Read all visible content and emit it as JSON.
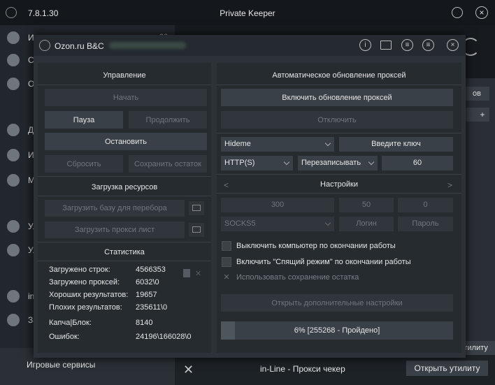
{
  "app": {
    "version": "7.8.1.30",
    "title": "Private Keeper"
  },
  "sidebar": {
    "items": [
      {
        "label": "И",
        "count": "20"
      },
      {
        "label": "С"
      },
      {
        "label": "О"
      },
      {
        "label": "Д"
      },
      {
        "label": "И"
      },
      {
        "label": "М"
      },
      {
        "label": "Ул"
      },
      {
        "label": "Ул"
      },
      {
        "label": "in"
      },
      {
        "label": "За"
      }
    ],
    "bottom_label": "Игровые сервисы"
  },
  "main": {
    "right_tab": "ов",
    "plus": "+",
    "strip_label": "утилиту",
    "bottom_label": "in-Line - Прокси чекер",
    "open_utility": "Открыть утилиту"
  },
  "dialog": {
    "title": "Ozon.ru B&C",
    "control": {
      "title": "Управление",
      "start": "Начать",
      "pause": "Пауза",
      "resume": "Продолжить",
      "stop": "Остановить",
      "reset": "Сбросить",
      "save_rest": "Сохранить остаток"
    },
    "resources": {
      "title": "Загрузка ресурсов",
      "load_base": "Загрузить базу для перебора",
      "load_proxy": "Загрузить прокси лист"
    },
    "stats": {
      "title": "Статистика",
      "rows": [
        {
          "k": "Загружено строк:",
          "v": "4566353"
        },
        {
          "k": "Загружено проксей:",
          "v": "6032\\0"
        },
        {
          "k": "Хороших результатов:",
          "v": "19657"
        },
        {
          "k": "Плохих результатов:",
          "v": "235611\\0"
        },
        {
          "k": "Капча|Блок:",
          "v": "8140"
        },
        {
          "k": "Ошибок:",
          "v": "24196\\166028\\0"
        }
      ]
    },
    "proxy": {
      "title": "Автоматическое обновление проксей",
      "enable": "Включить обновление проксей",
      "disable": "Отключить",
      "provider": "Hideme",
      "key_placeholder": "Введите ключ",
      "protocol": "HTTP(S)",
      "mode": "Перезаписывать",
      "interval": "60"
    },
    "settings": {
      "title": "Настройки",
      "threads": "300",
      "timeout": "50",
      "retries": "0",
      "proxy_type": "SOCKS5",
      "login": "Логин",
      "password": "Пароль",
      "shutdown": "Выключить компьютер по окончании работы",
      "sleep": "Включить \"Спящий режим\" по окончании работы",
      "save_rest_use": "Использовать сохранение остатка",
      "advanced": "Открыть дополнительные настройки"
    },
    "progress": {
      "label": "6% [255268 - Пройдено]",
      "percent": 6
    }
  }
}
